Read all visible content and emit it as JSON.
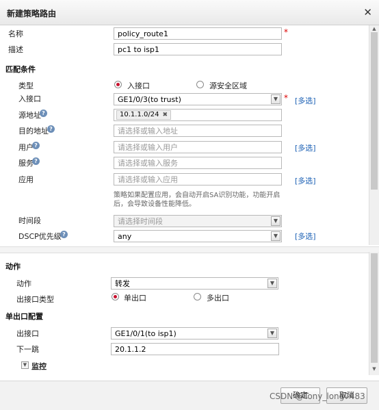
{
  "dialog": {
    "title": "新建策略路由",
    "close_icon": "close-icon"
  },
  "basic": {
    "name_label": "名称",
    "name_value": "policy_route1",
    "desc_label": "描述",
    "desc_value": "pc1 to isp1"
  },
  "match": {
    "section_title": "匹配条件",
    "type_label": "类型",
    "type_options": [
      "入接口",
      "源安全区域"
    ],
    "type_selected": "入接口",
    "in_interface_label": "入接口",
    "in_interface_value": "GE1/0/3(to trust)",
    "multi_select_label": "[多选]",
    "src_addr_label": "源地址",
    "src_addr_tag": "10.1.1.0/24",
    "dst_addr_label": "目的地址",
    "dst_addr_placeholder": "请选择或输入地址",
    "user_label": "用户",
    "user_placeholder": "请选择或输入用户",
    "service_label": "服务",
    "service_placeholder": "请选择或输入服务",
    "app_label": "应用",
    "app_placeholder": "请选择或输入应用",
    "app_note": "策略如果配置应用，会自动开启SA识别功能，功能开启后，会导致设备性能降低。",
    "time_label": "时间段",
    "time_placeholder": "请选择时间段",
    "dscp_label": "DSCP优先级",
    "dscp_value": "any"
  },
  "action": {
    "section_title": "动作",
    "action_label": "动作",
    "action_value": "转发",
    "out_type_label": "出接口类型",
    "out_type_options": [
      "单出口",
      "多出口"
    ],
    "out_type_selected": "单出口"
  },
  "single_exit": {
    "section_title": "单出口配置",
    "out_interface_label": "出接口",
    "out_interface_value": "GE1/0/1(to isp1)",
    "next_hop_label": "下一跳",
    "next_hop_value": "20.1.1.2",
    "monitor_label": "监控"
  },
  "footer": {
    "ok_label": "确定",
    "cancel_label": "取消",
    "watermark": "CSDN @Tony_long7483"
  }
}
